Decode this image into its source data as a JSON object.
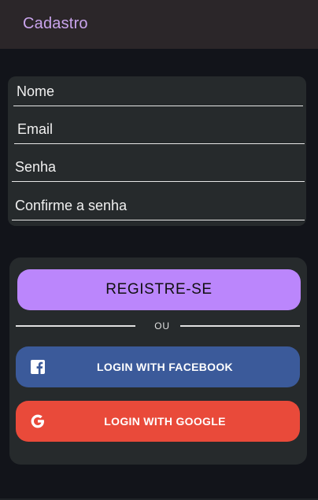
{
  "appbar": {
    "title": "Cadastro"
  },
  "form": {
    "nome_placeholder": "Nome",
    "email_placeholder": "Email",
    "senha_placeholder": "Senha",
    "confirm_placeholder": "Confirme a senha"
  },
  "actions": {
    "register_label": "REGISTRE-SE",
    "divider_text": "OU",
    "facebook_label": "LOGIN WITH FACEBOOK",
    "google_label": "LOGIN WITH GOOGLE"
  },
  "icons": {
    "facebook": "facebook-icon",
    "google": "google-icon"
  },
  "colors": {
    "accent": "#bb86fc",
    "facebook": "#3b5a9a",
    "google": "#e94a3a",
    "title": "#c9a4ec"
  }
}
